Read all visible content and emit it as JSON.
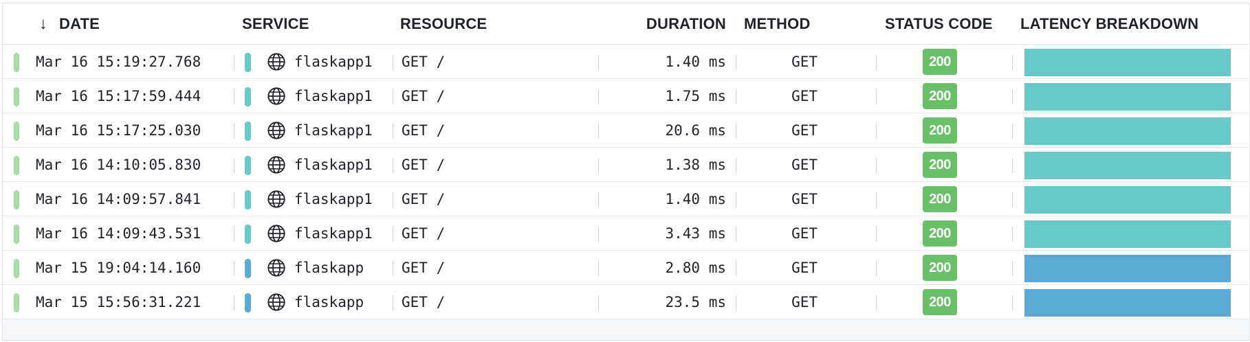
{
  "columns": {
    "date": "DATE",
    "service": "SERVICE",
    "resource": "RESOURCE",
    "duration": "DURATION",
    "method": "METHOD",
    "status_code": "STATUS CODE",
    "latency_breakdown": "LATENCY BREAKDOWN"
  },
  "sort_icon": "arrow-down-icon",
  "sort_glyph": "↓",
  "colors": {
    "status_ok": "#a8dba6",
    "badge_green": "#6abf69",
    "flaskapp1": "#69c8c8",
    "flaskapp": "#5aaad6"
  },
  "rows": [
    {
      "date": "Mar 16 15:19:27.768",
      "service": "flaskapp1",
      "service_color": "#69c8c8",
      "resource": "GET /",
      "duration": "1.40 ms",
      "method": "GET",
      "status": "200",
      "latency_color": "#69c8c8",
      "latency_fraction": 1.0
    },
    {
      "date": "Mar 16 15:17:59.444",
      "service": "flaskapp1",
      "service_color": "#69c8c8",
      "resource": "GET /",
      "duration": "1.75 ms",
      "method": "GET",
      "status": "200",
      "latency_color": "#69c8c8",
      "latency_fraction": 1.0
    },
    {
      "date": "Mar 16 15:17:25.030",
      "service": "flaskapp1",
      "service_color": "#69c8c8",
      "resource": "GET /",
      "duration": "20.6 ms",
      "method": "GET",
      "status": "200",
      "latency_color": "#69c8c8",
      "latency_fraction": 1.0
    },
    {
      "date": "Mar 16 14:10:05.830",
      "service": "flaskapp1",
      "service_color": "#69c8c8",
      "resource": "GET /",
      "duration": "1.38 ms",
      "method": "GET",
      "status": "200",
      "latency_color": "#69c8c8",
      "latency_fraction": 1.0
    },
    {
      "date": "Mar 16 14:09:57.841",
      "service": "flaskapp1",
      "service_color": "#69c8c8",
      "resource": "GET /",
      "duration": "1.40 ms",
      "method": "GET",
      "status": "200",
      "latency_color": "#69c8c8",
      "latency_fraction": 1.0
    },
    {
      "date": "Mar 16 14:09:43.531",
      "service": "flaskapp1",
      "service_color": "#69c8c8",
      "resource": "GET /",
      "duration": "3.43 ms",
      "method": "GET",
      "status": "200",
      "latency_color": "#69c8c8",
      "latency_fraction": 1.0
    },
    {
      "date": "Mar 15 19:04:14.160",
      "service": "flaskapp",
      "service_color": "#5aaad6",
      "resource": "GET /",
      "duration": "2.80 ms",
      "method": "GET",
      "status": "200",
      "latency_color": "#5aaad6",
      "latency_fraction": 1.0
    },
    {
      "date": "Mar 15 15:56:31.221",
      "service": "flaskapp",
      "service_color": "#5aaad6",
      "resource": "GET /",
      "duration": "23.5 ms",
      "method": "GET",
      "status": "200",
      "latency_color": "#5aaad6",
      "latency_fraction": 1.0
    }
  ]
}
